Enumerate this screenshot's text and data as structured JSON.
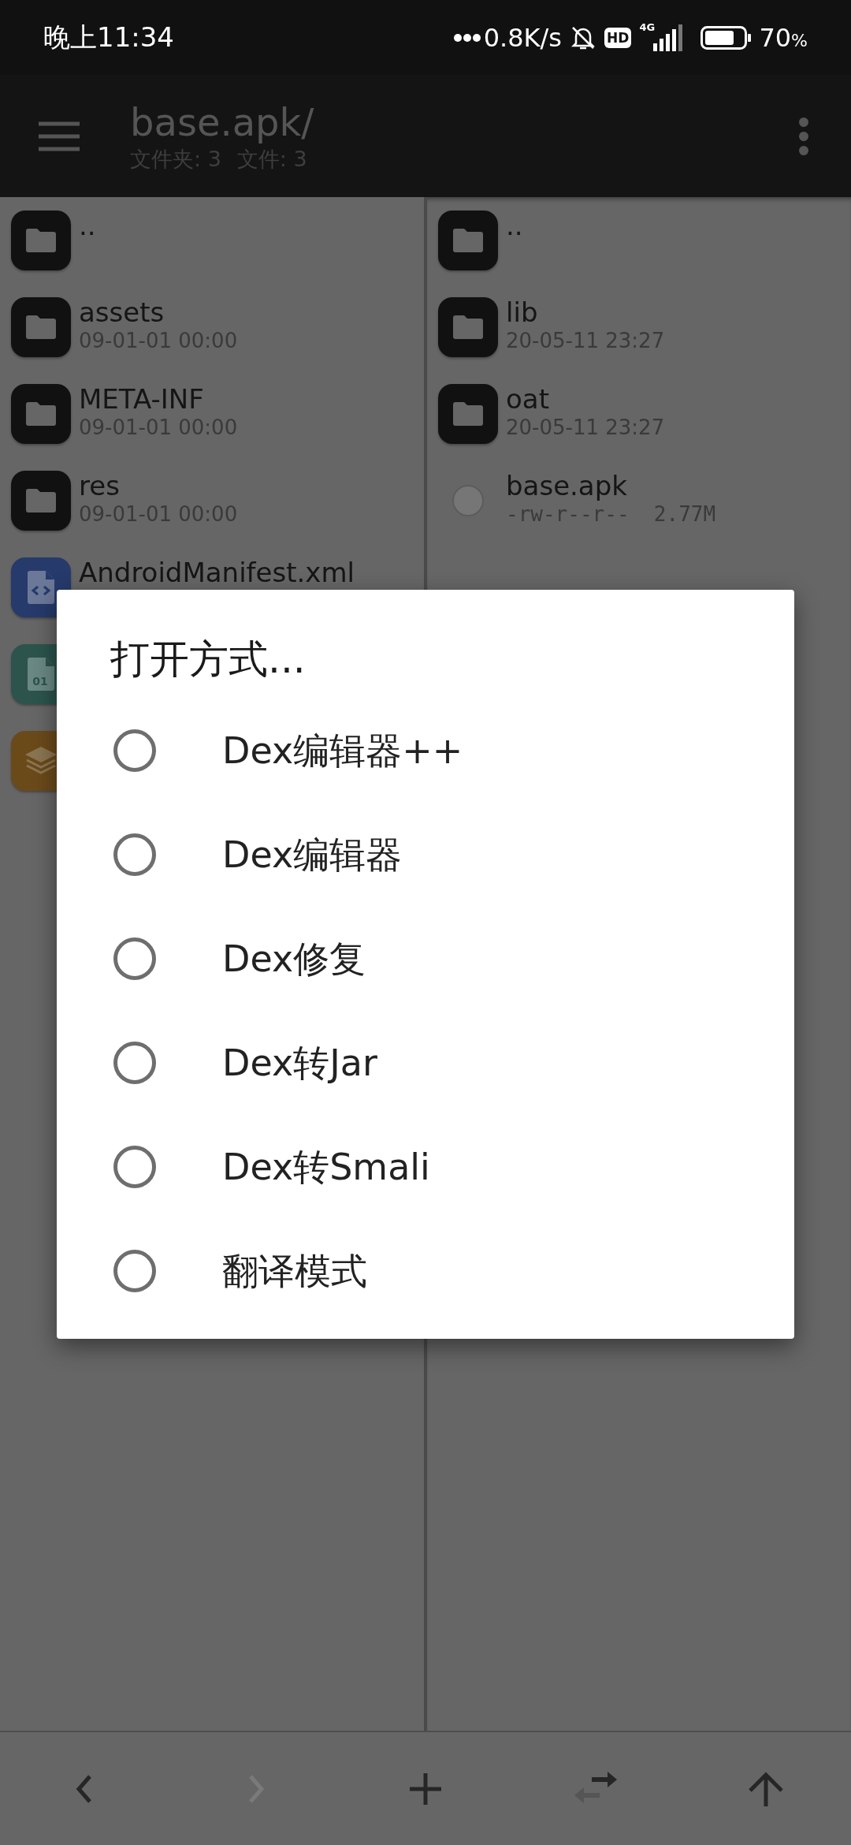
{
  "status_bar": {
    "time": "晚上11:34",
    "network_speed": "0.8K/s",
    "hd_badge": "HD",
    "signal_label": "4G",
    "battery": "70",
    "battery_unit": "%"
  },
  "toolbar": {
    "title": "base.apk/",
    "folder_count": "文件夹: 3",
    "file_count": "文件: 3"
  },
  "panes": [
    {
      "items": [
        {
          "kind": "folder",
          "name": ".."
        },
        {
          "kind": "folder",
          "name": "assets",
          "detail": "09-01-01 00:00"
        },
        {
          "kind": "folder",
          "name": "META-INF",
          "detail": "09-01-01 00:00"
        },
        {
          "kind": "folder",
          "name": "res",
          "detail": "09-01-01 00:00"
        },
        {
          "kind": "xml",
          "name": "AndroidManifest.xml"
        },
        {
          "kind": "binary",
          "icon_text": "01"
        },
        {
          "kind": "archive"
        }
      ]
    },
    {
      "items": [
        {
          "kind": "folder",
          "name": ".."
        },
        {
          "kind": "folder",
          "name": "lib",
          "detail": "20-05-11 23:27"
        },
        {
          "kind": "folder",
          "name": "oat",
          "detail": "20-05-11 23:27"
        },
        {
          "kind": "apk",
          "name": "base.apk",
          "detail": "-rw-r--r--  2.77M"
        }
      ]
    }
  ],
  "dialog": {
    "title": "打开方式...",
    "options": [
      {
        "label": "Dex编辑器++",
        "selected": false
      },
      {
        "label": "Dex编辑器",
        "selected": false
      },
      {
        "label": "Dex修复",
        "selected": false
      },
      {
        "label": "Dex转Jar",
        "selected": false
      },
      {
        "label": "Dex转Smali",
        "selected": false
      },
      {
        "label": "翻译模式",
        "selected": false
      }
    ]
  },
  "bottom_bar": [
    {
      "kind": "back",
      "disabled": false
    },
    {
      "kind": "forward",
      "disabled": true
    },
    {
      "kind": "add",
      "disabled": false
    },
    {
      "kind": "swap",
      "disabled": false
    },
    {
      "kind": "up",
      "disabled": false
    }
  ]
}
